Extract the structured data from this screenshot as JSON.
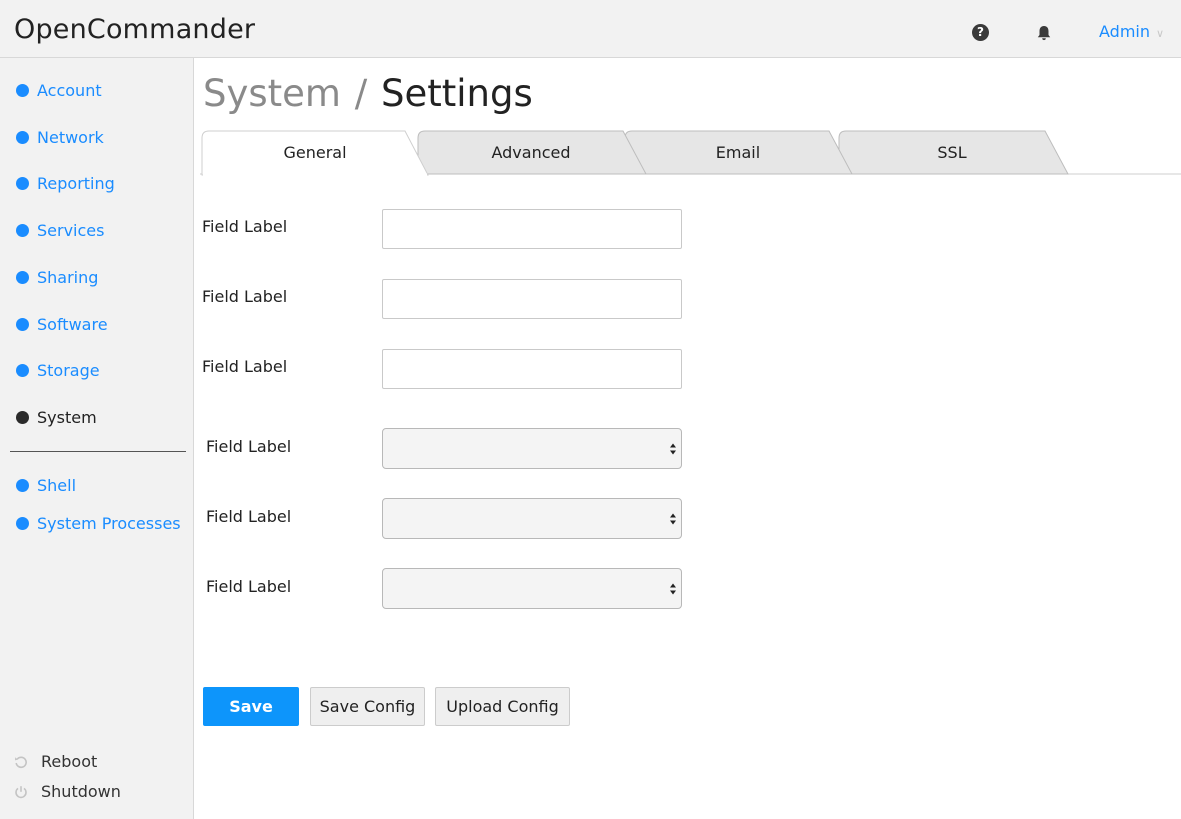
{
  "header": {
    "app_title": "OpenCommander",
    "help_icon": "?",
    "user_label": "Admin",
    "user_chevron": "∨"
  },
  "sidebar": {
    "items": [
      {
        "label": "Account"
      },
      {
        "label": "Network"
      },
      {
        "label": "Reporting"
      },
      {
        "label": "Services"
      },
      {
        "label": "Sharing"
      },
      {
        "label": "Software"
      },
      {
        "label": "Storage"
      },
      {
        "label": "System",
        "active": true
      }
    ],
    "secondary_items": [
      {
        "label": "Shell"
      },
      {
        "label": "System Processes"
      }
    ],
    "power_items": [
      {
        "label": "Reboot",
        "icon": "reboot-icon"
      },
      {
        "label": "Shutdown",
        "icon": "power-icon"
      }
    ]
  },
  "page": {
    "breadcrumb_parent": "System",
    "breadcrumb_separator": "/",
    "title": "Settings"
  },
  "tabs": [
    {
      "label": "General",
      "active": true
    },
    {
      "label": "Advanced"
    },
    {
      "label": "Email"
    },
    {
      "label": "SSL"
    }
  ],
  "form": {
    "text_fields": [
      {
        "label": "Field Label",
        "value": ""
      },
      {
        "label": "Field Label",
        "value": ""
      },
      {
        "label": "Field Label",
        "value": ""
      }
    ],
    "select_fields": [
      {
        "label": "Field Label",
        "value": ""
      },
      {
        "label": "Field Label",
        "value": ""
      },
      {
        "label": "Field Label",
        "value": ""
      }
    ]
  },
  "actions": {
    "save": "Save",
    "save_config": "Save Config",
    "upload_config": "Upload Config"
  },
  "colors": {
    "accent": "#1a8cff",
    "primary_button": "#0d95fb",
    "sidebar_bg": "#f2f2f2",
    "tab_inactive": "#e6e6e6"
  }
}
